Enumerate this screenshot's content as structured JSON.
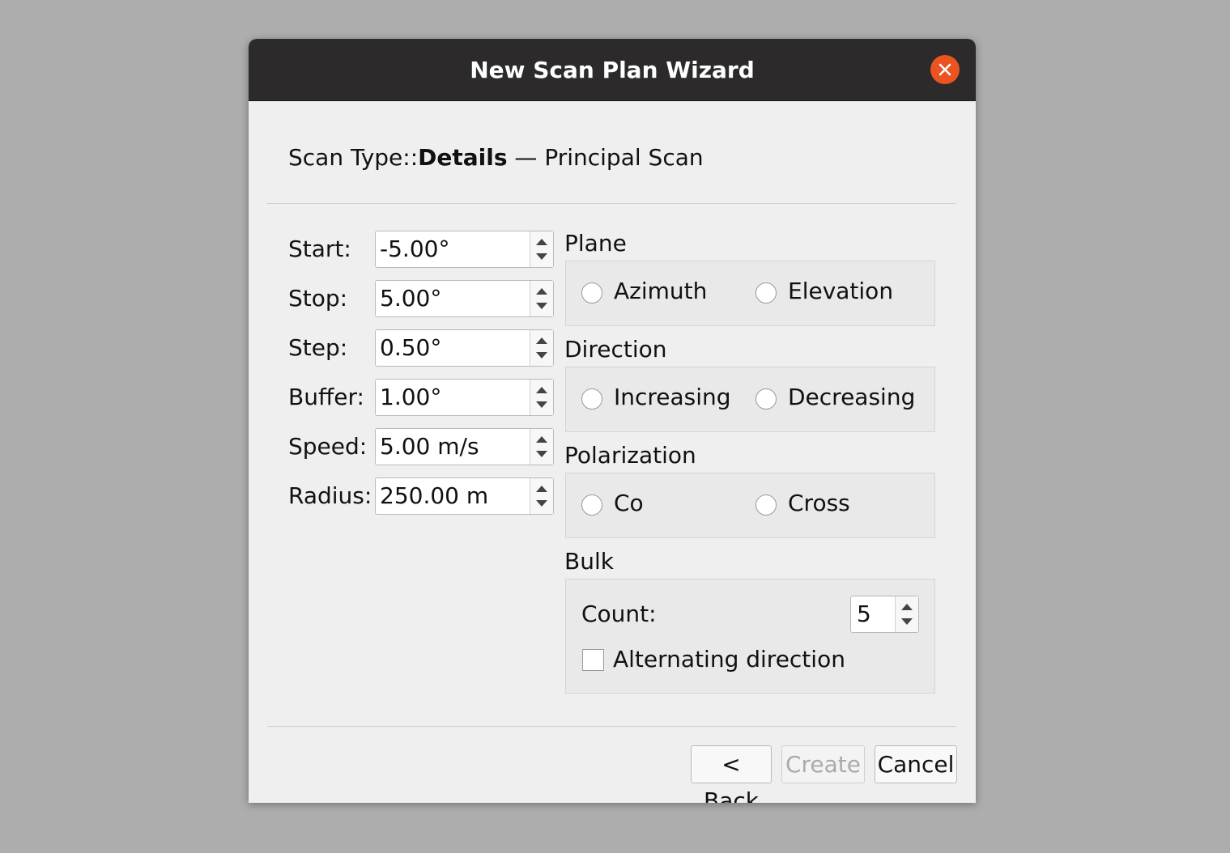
{
  "window": {
    "title": "New Scan Plan Wizard"
  },
  "header": {
    "prefix": "Scan Type::",
    "bold": "Details",
    "suffix": " — Principal Scan"
  },
  "fields": [
    {
      "label": "Start:",
      "value": "-5.00°"
    },
    {
      "label": "Stop:",
      "value": "5.00°"
    },
    {
      "label": "Step:",
      "value": "0.50°"
    },
    {
      "label": "Buffer:",
      "value": "1.00°"
    },
    {
      "label": "Speed:",
      "value": "5.00 m/s"
    },
    {
      "label": "Radius:",
      "value": "250.00 m"
    }
  ],
  "plane": {
    "title": "Plane",
    "options": [
      "Azimuth",
      "Elevation"
    ],
    "selected": null
  },
  "direction": {
    "title": "Direction",
    "options": [
      "Increasing",
      "Decreasing"
    ],
    "selected": null
  },
  "polarization": {
    "title": "Polarization",
    "options": [
      "Co",
      "Cross"
    ],
    "selected": null
  },
  "bulk": {
    "title": "Bulk",
    "count_label": "Count:",
    "count_value": "5",
    "alternating_label": "Alternating direction",
    "alternating_checked": false
  },
  "buttons": {
    "back_prefix": "< ",
    "back_mnemonic": "B",
    "back_rest": "ack",
    "create": "Create",
    "cancel": "Cancel"
  },
  "colors": {
    "titlebar": "#2c2a2b",
    "close_accent": "#e95420",
    "dialog_bg": "#efefef"
  }
}
